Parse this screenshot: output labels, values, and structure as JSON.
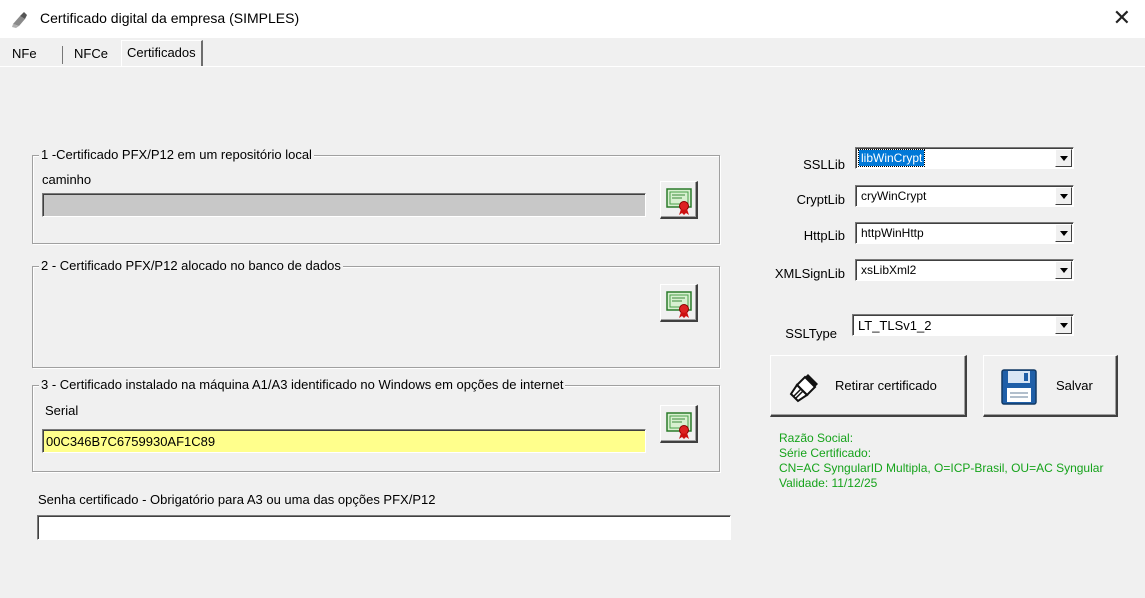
{
  "window": {
    "title": "Certificado digital da empresa (SIMPLES)",
    "close": "✕"
  },
  "tabs": [
    {
      "label": "NFe"
    },
    {
      "label": "NFCe"
    },
    {
      "label": "Certificados"
    }
  ],
  "group1": {
    "legend": "1 -Certificado PFX/P12 em um repositório local",
    "field_label": "caminho",
    "value": ""
  },
  "group2": {
    "legend": "2 - Certificado PFX/P12 alocado no banco de dados"
  },
  "group3": {
    "legend": "3 - Certificado instalado na máquina A1/A3 identificado no Windows em opções de internet",
    "field_label": "Serial",
    "value": "00C346B7C6759930AF1C89"
  },
  "senha": {
    "label": "Senha certificado - Obrigatório para A3 ou uma das opções PFX/P12",
    "value": ""
  },
  "config": {
    "ssllib": {
      "label": "SSLLib",
      "value": "libWinCrypt"
    },
    "cryptlib": {
      "label": "CryptLib",
      "value": "cryWinCrypt"
    },
    "httplib": {
      "label": "HttpLib",
      "value": "httpWinHttp"
    },
    "xmlsignlib": {
      "label": "XMLSignLib",
      "value": "xsLibXml2"
    },
    "ssltype": {
      "label": "SSLType",
      "value": "LT_TLSv1_2"
    }
  },
  "buttons": {
    "retirar": "Retirar certificado",
    "salvar": "Salvar"
  },
  "info": {
    "razao_social": "Razão Social:",
    "serie": "Série Certificado:",
    "cn": "CN=AC SyngularID Multipla, O=ICP-Brasil, OU=AC Syngular",
    "validade": "Validade: 11/12/25"
  },
  "colors": {
    "info_text": "#16a31b",
    "highlight": "#0078d7",
    "serial_bg": "#ffff8c",
    "disabled_bg": "#c8c8c8"
  }
}
